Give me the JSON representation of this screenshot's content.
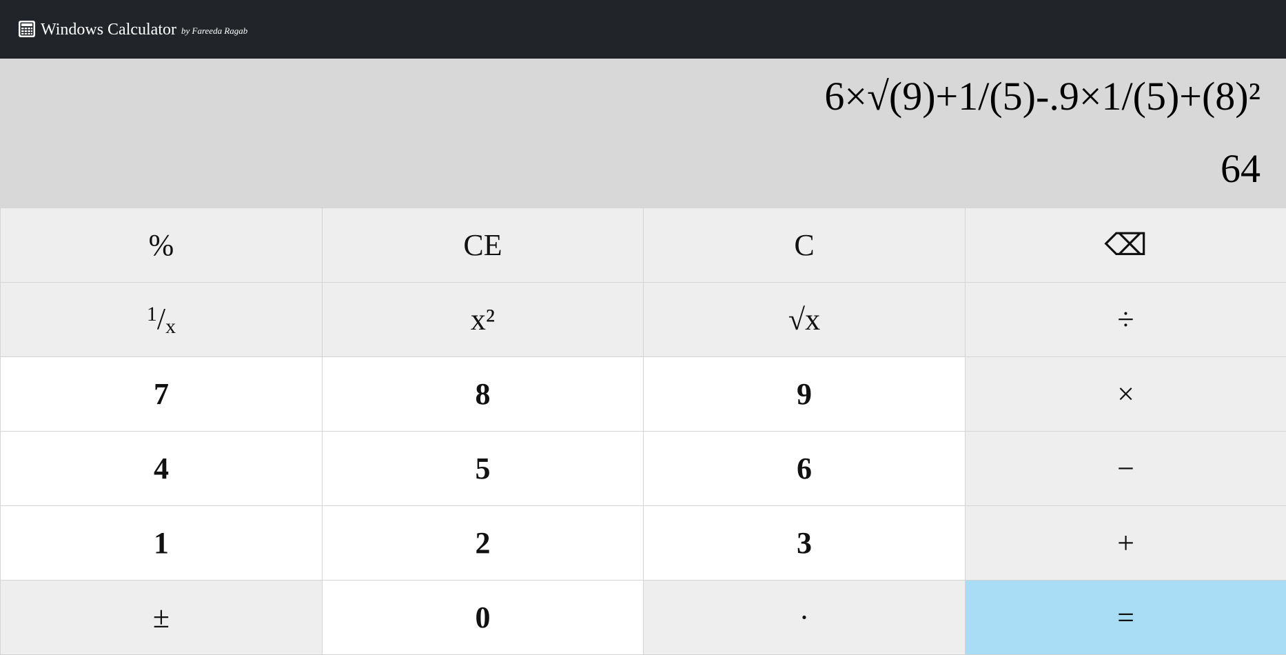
{
  "header": {
    "icon": "calculator-icon",
    "title": "Windows Calculator",
    "byline": "by Fareeda Ragab"
  },
  "display": {
    "expression": "6×√(9)+1/(5)-.9×1/(5)+(8)²",
    "result": "64"
  },
  "keys": [
    {
      "label": "%",
      "name": "percent-button",
      "kind": "fn"
    },
    {
      "label": "CE",
      "name": "clear-entry-button",
      "kind": "fn"
    },
    {
      "label": "C",
      "name": "clear-button",
      "kind": "fn"
    },
    {
      "label": "⌫",
      "name": "backspace-button",
      "kind": "fn"
    },
    {
      "label": "1/x",
      "name": "reciprocal-button",
      "kind": "fn"
    },
    {
      "label": "x²",
      "name": "square-button",
      "kind": "fn"
    },
    {
      "label": "√x",
      "name": "square-root-button",
      "kind": "fn"
    },
    {
      "label": "÷",
      "name": "divide-button",
      "kind": "fn"
    },
    {
      "label": "7",
      "name": "digit-7-button",
      "kind": "digit"
    },
    {
      "label": "8",
      "name": "digit-8-button",
      "kind": "digit"
    },
    {
      "label": "9",
      "name": "digit-9-button",
      "kind": "digit"
    },
    {
      "label": "×",
      "name": "multiply-button",
      "kind": "fn"
    },
    {
      "label": "4",
      "name": "digit-4-button",
      "kind": "digit"
    },
    {
      "label": "5",
      "name": "digit-5-button",
      "kind": "digit"
    },
    {
      "label": "6",
      "name": "digit-6-button",
      "kind": "digit"
    },
    {
      "label": "−",
      "name": "subtract-button",
      "kind": "fn"
    },
    {
      "label": "1",
      "name": "digit-1-button",
      "kind": "digit"
    },
    {
      "label": "2",
      "name": "digit-2-button",
      "kind": "digit"
    },
    {
      "label": "3",
      "name": "digit-3-button",
      "kind": "digit"
    },
    {
      "label": "+",
      "name": "add-button",
      "kind": "fn"
    },
    {
      "label": "±",
      "name": "negate-button",
      "kind": "fn"
    },
    {
      "label": "0",
      "name": "digit-0-button",
      "kind": "digit"
    },
    {
      "label": "·",
      "name": "decimal-button",
      "kind": "fn"
    },
    {
      "label": "=",
      "name": "equals-button",
      "kind": "equals"
    }
  ],
  "colors": {
    "header_bg": "#212529",
    "display_bg": "#d8d8d8",
    "function_key_bg": "#eeeeee",
    "digit_key_bg": "#ffffff",
    "equals_key_bg": "#a8ddf5"
  }
}
